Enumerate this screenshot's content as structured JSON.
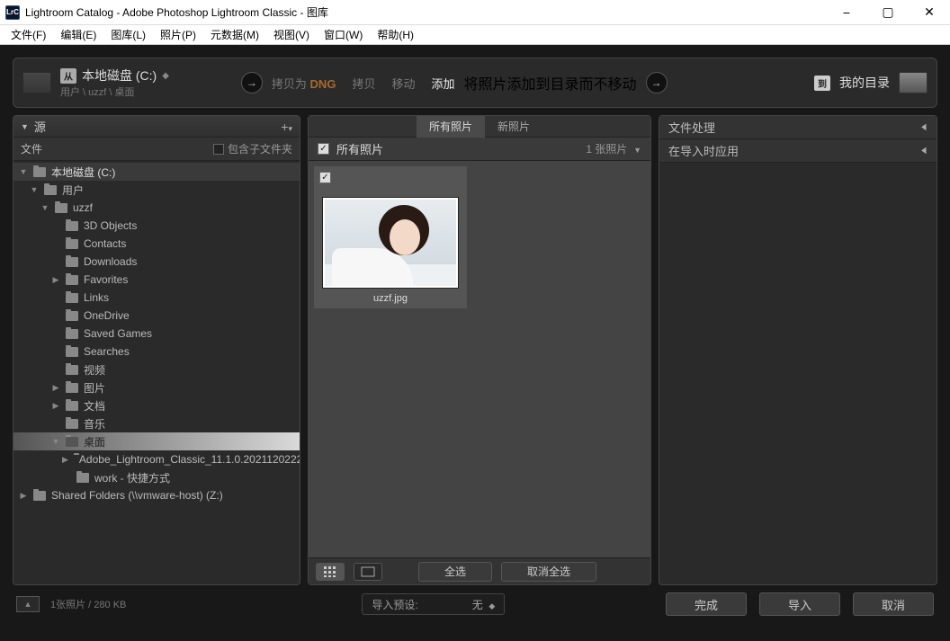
{
  "window": {
    "title": "Lightroom Catalog - Adobe Photoshop Lightroom Classic - 图库",
    "icon_text": "LrC"
  },
  "menu": [
    "文件(F)",
    "编辑(E)",
    "图库(L)",
    "照片(P)",
    "元数据(M)",
    "视图(V)",
    "窗口(W)",
    "帮助(H)"
  ],
  "topbar": {
    "from_badge": "从",
    "source_drive": "本地磁盘 (C:)",
    "source_path": "用户 \\ uzzf \\ 桌面",
    "actions": [
      {
        "l1": "拷贝为 DNG"
      },
      {
        "l1": "拷贝"
      },
      {
        "l1": "移动"
      },
      {
        "l1": "添加",
        "selected": true
      }
    ],
    "action_sub": "将照片添加到目录而不移动",
    "to_badge": "到",
    "dest_label": "我的目录"
  },
  "left": {
    "panel_title": "源",
    "sub_label": "文件",
    "sub_chk_label": "包含子文件夹",
    "tree": [
      {
        "label": "本地磁盘 (C:)",
        "type": "drive",
        "indent": 0,
        "arrow": "▼"
      },
      {
        "label": "用户",
        "indent": 1,
        "arrow": "▼"
      },
      {
        "label": "uzzf",
        "indent": 2,
        "arrow": "▼"
      },
      {
        "label": "3D Objects",
        "indent": 3,
        "arrow": ""
      },
      {
        "label": "Contacts",
        "indent": 3,
        "arrow": ""
      },
      {
        "label": "Downloads",
        "indent": 3,
        "arrow": ""
      },
      {
        "label": "Favorites",
        "indent": 3,
        "arrow": "▶"
      },
      {
        "label": "Links",
        "indent": 3,
        "arrow": ""
      },
      {
        "label": "OneDrive",
        "indent": 3,
        "arrow": ""
      },
      {
        "label": "Saved Games",
        "indent": 3,
        "arrow": ""
      },
      {
        "label": "Searches",
        "indent": 3,
        "arrow": ""
      },
      {
        "label": "视频",
        "indent": 3,
        "arrow": ""
      },
      {
        "label": "图片",
        "indent": 3,
        "arrow": "▶"
      },
      {
        "label": "文档",
        "indent": 3,
        "arrow": "▶"
      },
      {
        "label": "音乐",
        "indent": 3,
        "arrow": ""
      },
      {
        "label": "桌面",
        "indent": 3,
        "arrow": "▼",
        "selected": true
      },
      {
        "label": "Adobe_Lightroom_Classic_11.1.0.2021120222...",
        "indent": 4,
        "arrow": "▶"
      },
      {
        "label": "work - 快捷方式",
        "indent": 4,
        "arrow": ""
      },
      {
        "label": "Shared Folders (\\\\vmware-host) (Z:)",
        "indent": 0,
        "arrow": "▶"
      }
    ]
  },
  "mid": {
    "tabs": [
      {
        "label": "所有照片",
        "active": true
      },
      {
        "label": "新照片"
      }
    ],
    "section_title": "所有照片",
    "count_label": "1 张照片",
    "thumb_filename": "uzzf.jpg",
    "btn_select_all": "全选",
    "btn_deselect_all": "取消全选"
  },
  "right": {
    "rows": [
      "文件处理",
      "在导入时应用"
    ]
  },
  "bottom": {
    "status": "1张照片 / 280 KB",
    "preset_label": "导入预设:",
    "preset_value": "无",
    "done": "完成",
    "import": "导入",
    "cancel": "取消"
  }
}
